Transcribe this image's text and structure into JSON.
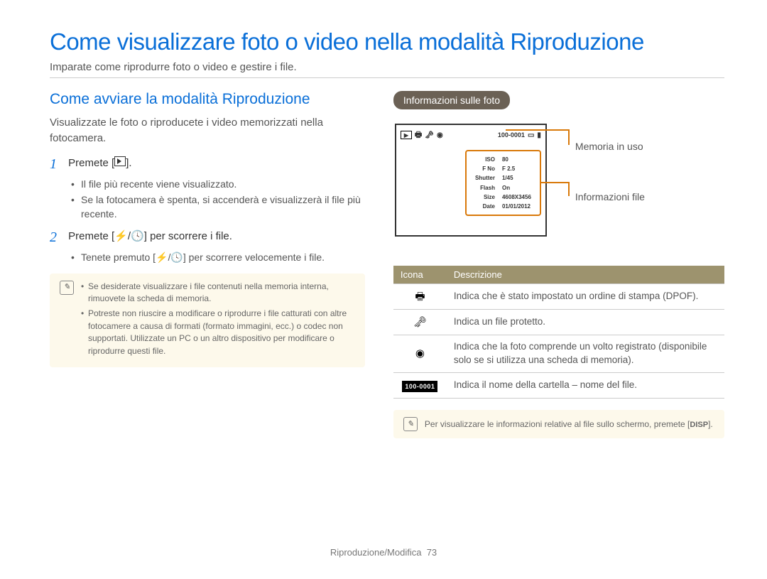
{
  "title": "Come visualizzare foto o video nella modalità Riproduzione",
  "intro": "Imparate come riprodurre foto o video e gestire i file.",
  "left": {
    "heading": "Come avviare la modalità Riproduzione",
    "para": "Visualizzate le foto o riproducete i video memorizzati nella fotocamera.",
    "step1_num": "1",
    "step1_text_a": "Premete [",
    "step1_text_b": "].",
    "step1_bul1": "Il file più recente viene visualizzato.",
    "step1_bul2": "Se la fotocamera è spenta, si accenderà e visualizzerà il file più recente.",
    "step2_num": "2",
    "step2_text_a": "Premete [",
    "step2_text_b": "] per scorrere i file.",
    "step2_bul1_a": "Tenete premuto [",
    "step2_bul1_b": "] per scorrere velocemente i file.",
    "note1": "Se desiderate visualizzare i file contenuti nella memoria interna, rimuovete la scheda di memoria.",
    "note2": "Potreste non riuscire a modificare o riprodurre i file catturati con altre fotocamere a causa di formati (formato immagini, ecc.) o codec non supportati. Utilizzate un PC o un altro dispositivo per modificare o riprodurre questi file."
  },
  "right": {
    "pill": "Informazioni sulle foto",
    "camtop_code": "100-0001",
    "callout_mem": "Memoria in uso",
    "callout_info": "Informazioni file",
    "info": {
      "iso_l": "ISO",
      "iso_v": "80",
      "fno_l": "F No",
      "fno_v": "F 2.5",
      "sh_l": "Shutter",
      "sh_v": "1/45",
      "fl_l": "Flash",
      "fl_v": "On",
      "sz_l": "Size",
      "sz_v": "4608X3456",
      "dt_l": "Date",
      "dt_v": "01/01/2012"
    },
    "th_icon": "Icona",
    "th_desc": "Descrizione",
    "row1_desc": "Indica che è stato impostato un ordine di stampa (DPOF).",
    "row2_desc": "Indica un file protetto.",
    "row3_desc": "Indica che la foto comprende un volto registrato (disponibile solo se si utilizza una scheda di memoria).",
    "row4_icon": "100-0001",
    "row4_desc": "Indica il nome della cartella – nome del file.",
    "bottom_note_a": "Per visualizzare le informazioni relative al file sullo schermo, premete [",
    "bottom_note_b": "].",
    "disp": "DISP"
  },
  "footer_a": "Riproduzione/Modifica",
  "footer_b": "73"
}
